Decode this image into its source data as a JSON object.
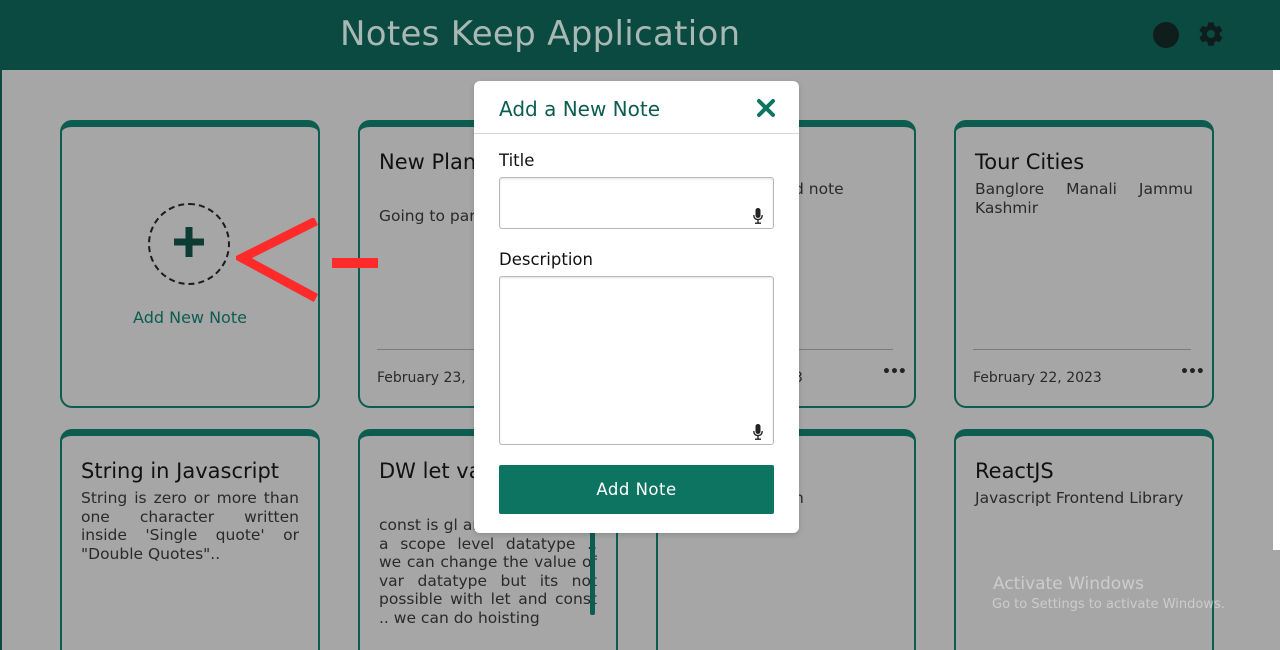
{
  "header": {
    "title": "Notes Keep Application"
  },
  "add_card": {
    "label": "Add New Note"
  },
  "notes": [
    {
      "title": "New Plan today",
      "description": "Going to park Going",
      "date": "February 23,",
      "more": "•••"
    },
    {
      "title": "",
      "description": "d note",
      "date": "3",
      "more": "•••"
    },
    {
      "title": "Tour Cities",
      "description": "Banglore Manali Jammu Kashmir",
      "date": "February 22, 2023",
      "more": "•••"
    },
    {
      "title": "String in Javascript",
      "description": "String is zero or more than one character written inside 'Single quote' or \"Double Quotes\"..",
      "date": "",
      "more": ""
    },
    {
      "title": "DW let var const",
      "description": "const is gl and let & var has a scope level datatype .. we can change the value of var datatype but its not possible with let and const .. we can do hoisting",
      "date": "",
      "more": ""
    },
    {
      "title": "",
      "description": "n",
      "date": "",
      "more": ""
    },
    {
      "title": "ReactJS",
      "description": "Javascript Frontend Library",
      "date": "",
      "more": ""
    }
  ],
  "modal": {
    "title": "Add a New Note",
    "title_label": "Title",
    "title_value": "",
    "description_label": "Description",
    "description_value": "",
    "submit_label": "Add Note"
  },
  "watermark": {
    "line1": "Activate Windows",
    "line2": "Go to Settings to activate Windows."
  },
  "colors": {
    "header": "#0a4a40",
    "accent": "#0d7462",
    "overlay": "#a6a6a6",
    "annotation": "#ff2a2a"
  }
}
